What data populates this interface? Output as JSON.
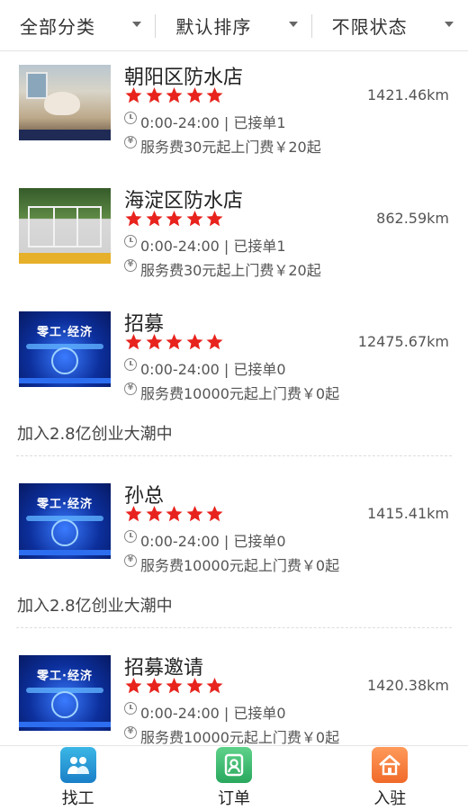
{
  "filters": [
    {
      "label": "全部分类"
    },
    {
      "label": "默认排序"
    },
    {
      "label": "不限状态"
    }
  ],
  "shops": [
    {
      "name": "朝阳区防水店",
      "distance": "1421.46km",
      "hours": "0:00-24:00 | 已接单1",
      "fee": "服务费30元起上门费￥20起",
      "rating": 5,
      "thumb": "bathroom-photo",
      "desc": ""
    },
    {
      "name": "海淀区防水店",
      "distance": "862.59km",
      "hours": "0:00-24:00 | 已接单1",
      "fee": "服务费30元起上门费￥20起",
      "rating": 5,
      "thumb": "sunroom-photo",
      "desc": ""
    },
    {
      "name": "招募",
      "distance": "12475.67km",
      "hours": "0:00-24:00 | 已接单0",
      "fee": "服务费10000元起上门费￥0起",
      "rating": 5,
      "thumb": "recruit-poster",
      "desc": "加入2.8亿创业大潮中"
    },
    {
      "name": "孙总",
      "distance": "1415.41km",
      "hours": "0:00-24:00 | 已接单0",
      "fee": "服务费10000元起上门费￥0起",
      "rating": 5,
      "thumb": "recruit-poster",
      "desc": "加入2.8亿创业大潮中"
    },
    {
      "name": "招募邀请",
      "distance": "1420.38km",
      "hours": "0:00-24:00 | 已接单0",
      "fee": "服务费10000元起上门费￥0起",
      "rating": 5,
      "thumb": "recruit-poster",
      "desc": ""
    }
  ],
  "poster_text": "零工·经济",
  "tabs": [
    {
      "label": "找工",
      "icon": "workers-icon"
    },
    {
      "label": "订单",
      "icon": "orders-icon"
    },
    {
      "label": "入驻",
      "icon": "home-join-icon"
    }
  ],
  "colors": {
    "star": "#e8231d",
    "text": "#222222",
    "muted": "#555555"
  }
}
